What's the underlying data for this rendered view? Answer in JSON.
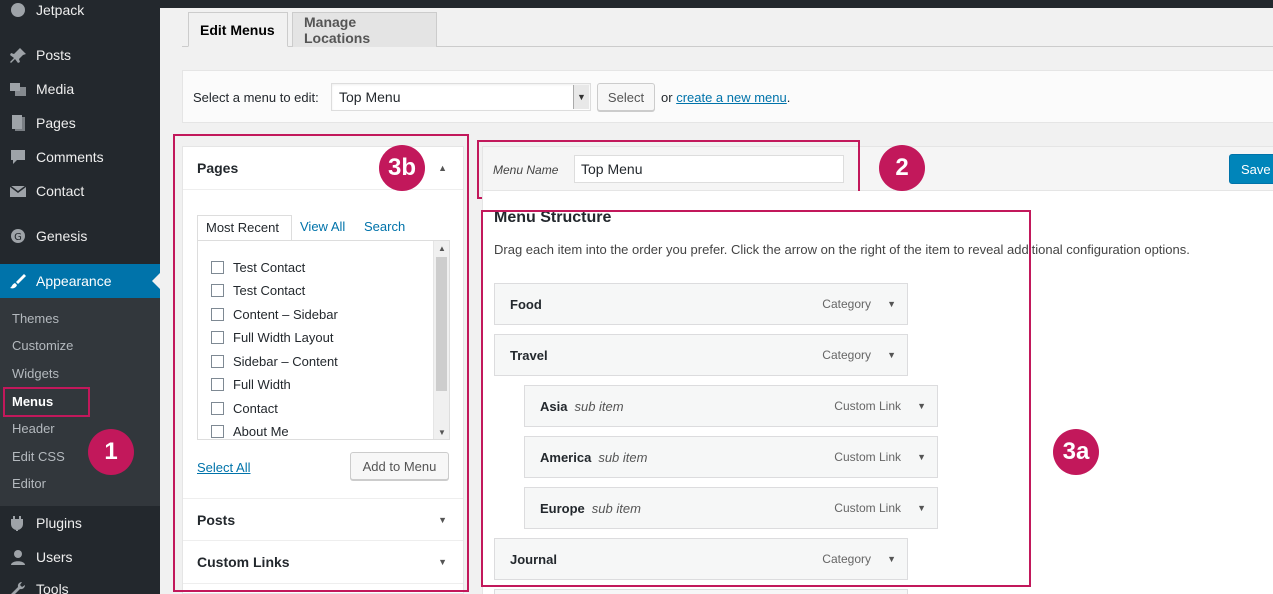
{
  "sidebar": {
    "items": [
      {
        "label": "Jetpack",
        "icon": "jetpack-icon"
      },
      {
        "label": "Posts",
        "icon": "pin-icon"
      },
      {
        "label": "Media",
        "icon": "media-icon"
      },
      {
        "label": "Pages",
        "icon": "pages-icon"
      },
      {
        "label": "Comments",
        "icon": "comment-icon"
      },
      {
        "label": "Contact",
        "icon": "mail-icon"
      },
      {
        "label": "Genesis",
        "icon": "genesis-icon"
      },
      {
        "label": "Appearance",
        "icon": "brush-icon"
      },
      {
        "label": "Plugins",
        "icon": "plug-icon"
      },
      {
        "label": "Users",
        "icon": "user-icon"
      },
      {
        "label": "Tools",
        "icon": "wrench-icon"
      }
    ],
    "submenu": [
      "Themes",
      "Customize",
      "Widgets",
      "Menus",
      "Header",
      "Edit CSS",
      "Editor"
    ]
  },
  "annotations": {
    "one": "1",
    "two": "2",
    "three_a": "3a",
    "three_b": "3b"
  },
  "tabs": {
    "edit_menus": "Edit Menus",
    "manage_locations": "Manage Locations"
  },
  "manage": {
    "label": "Select a menu to edit:",
    "selected": "Top Menu",
    "select_button": "Select",
    "or_text": "or",
    "create_link": "create a new menu",
    "period": "."
  },
  "pages_box": {
    "title": "Pages",
    "tabs": [
      "Most Recent",
      "View All",
      "Search"
    ],
    "items": [
      "Test Contact",
      "Test Contact",
      "Content – Sidebar",
      "Full Width Layout",
      "Sidebar – Content",
      "Full Width",
      "Contact",
      "About Me"
    ],
    "select_all": "Select All",
    "add_button": "Add to Menu"
  },
  "accordion": {
    "posts": "Posts",
    "custom_links": "Custom Links"
  },
  "menu_settings": {
    "name_label": "Menu Name",
    "name_value": "Top Menu",
    "save_label": "Save"
  },
  "structure": {
    "title": "Menu Structure",
    "description": "Drag each item into the order you prefer. Click the arrow on the right of the item to reveal additional configuration options.",
    "items": [
      {
        "title": "Food",
        "sub": "",
        "type": "Category"
      },
      {
        "title": "Travel",
        "sub": "",
        "type": "Category"
      },
      {
        "title": "Asia",
        "sub": "sub item",
        "type": "Custom Link"
      },
      {
        "title": "America",
        "sub": "sub item",
        "type": "Custom Link"
      },
      {
        "title": "Europe",
        "sub": "sub item",
        "type": "Custom Link"
      },
      {
        "title": "Journal",
        "sub": "",
        "type": "Category"
      }
    ]
  },
  "colors": {
    "admin_bg": "#23282d",
    "submenu_bg": "#32373c",
    "accent": "#0073aa",
    "annotation": "#c2185b"
  }
}
